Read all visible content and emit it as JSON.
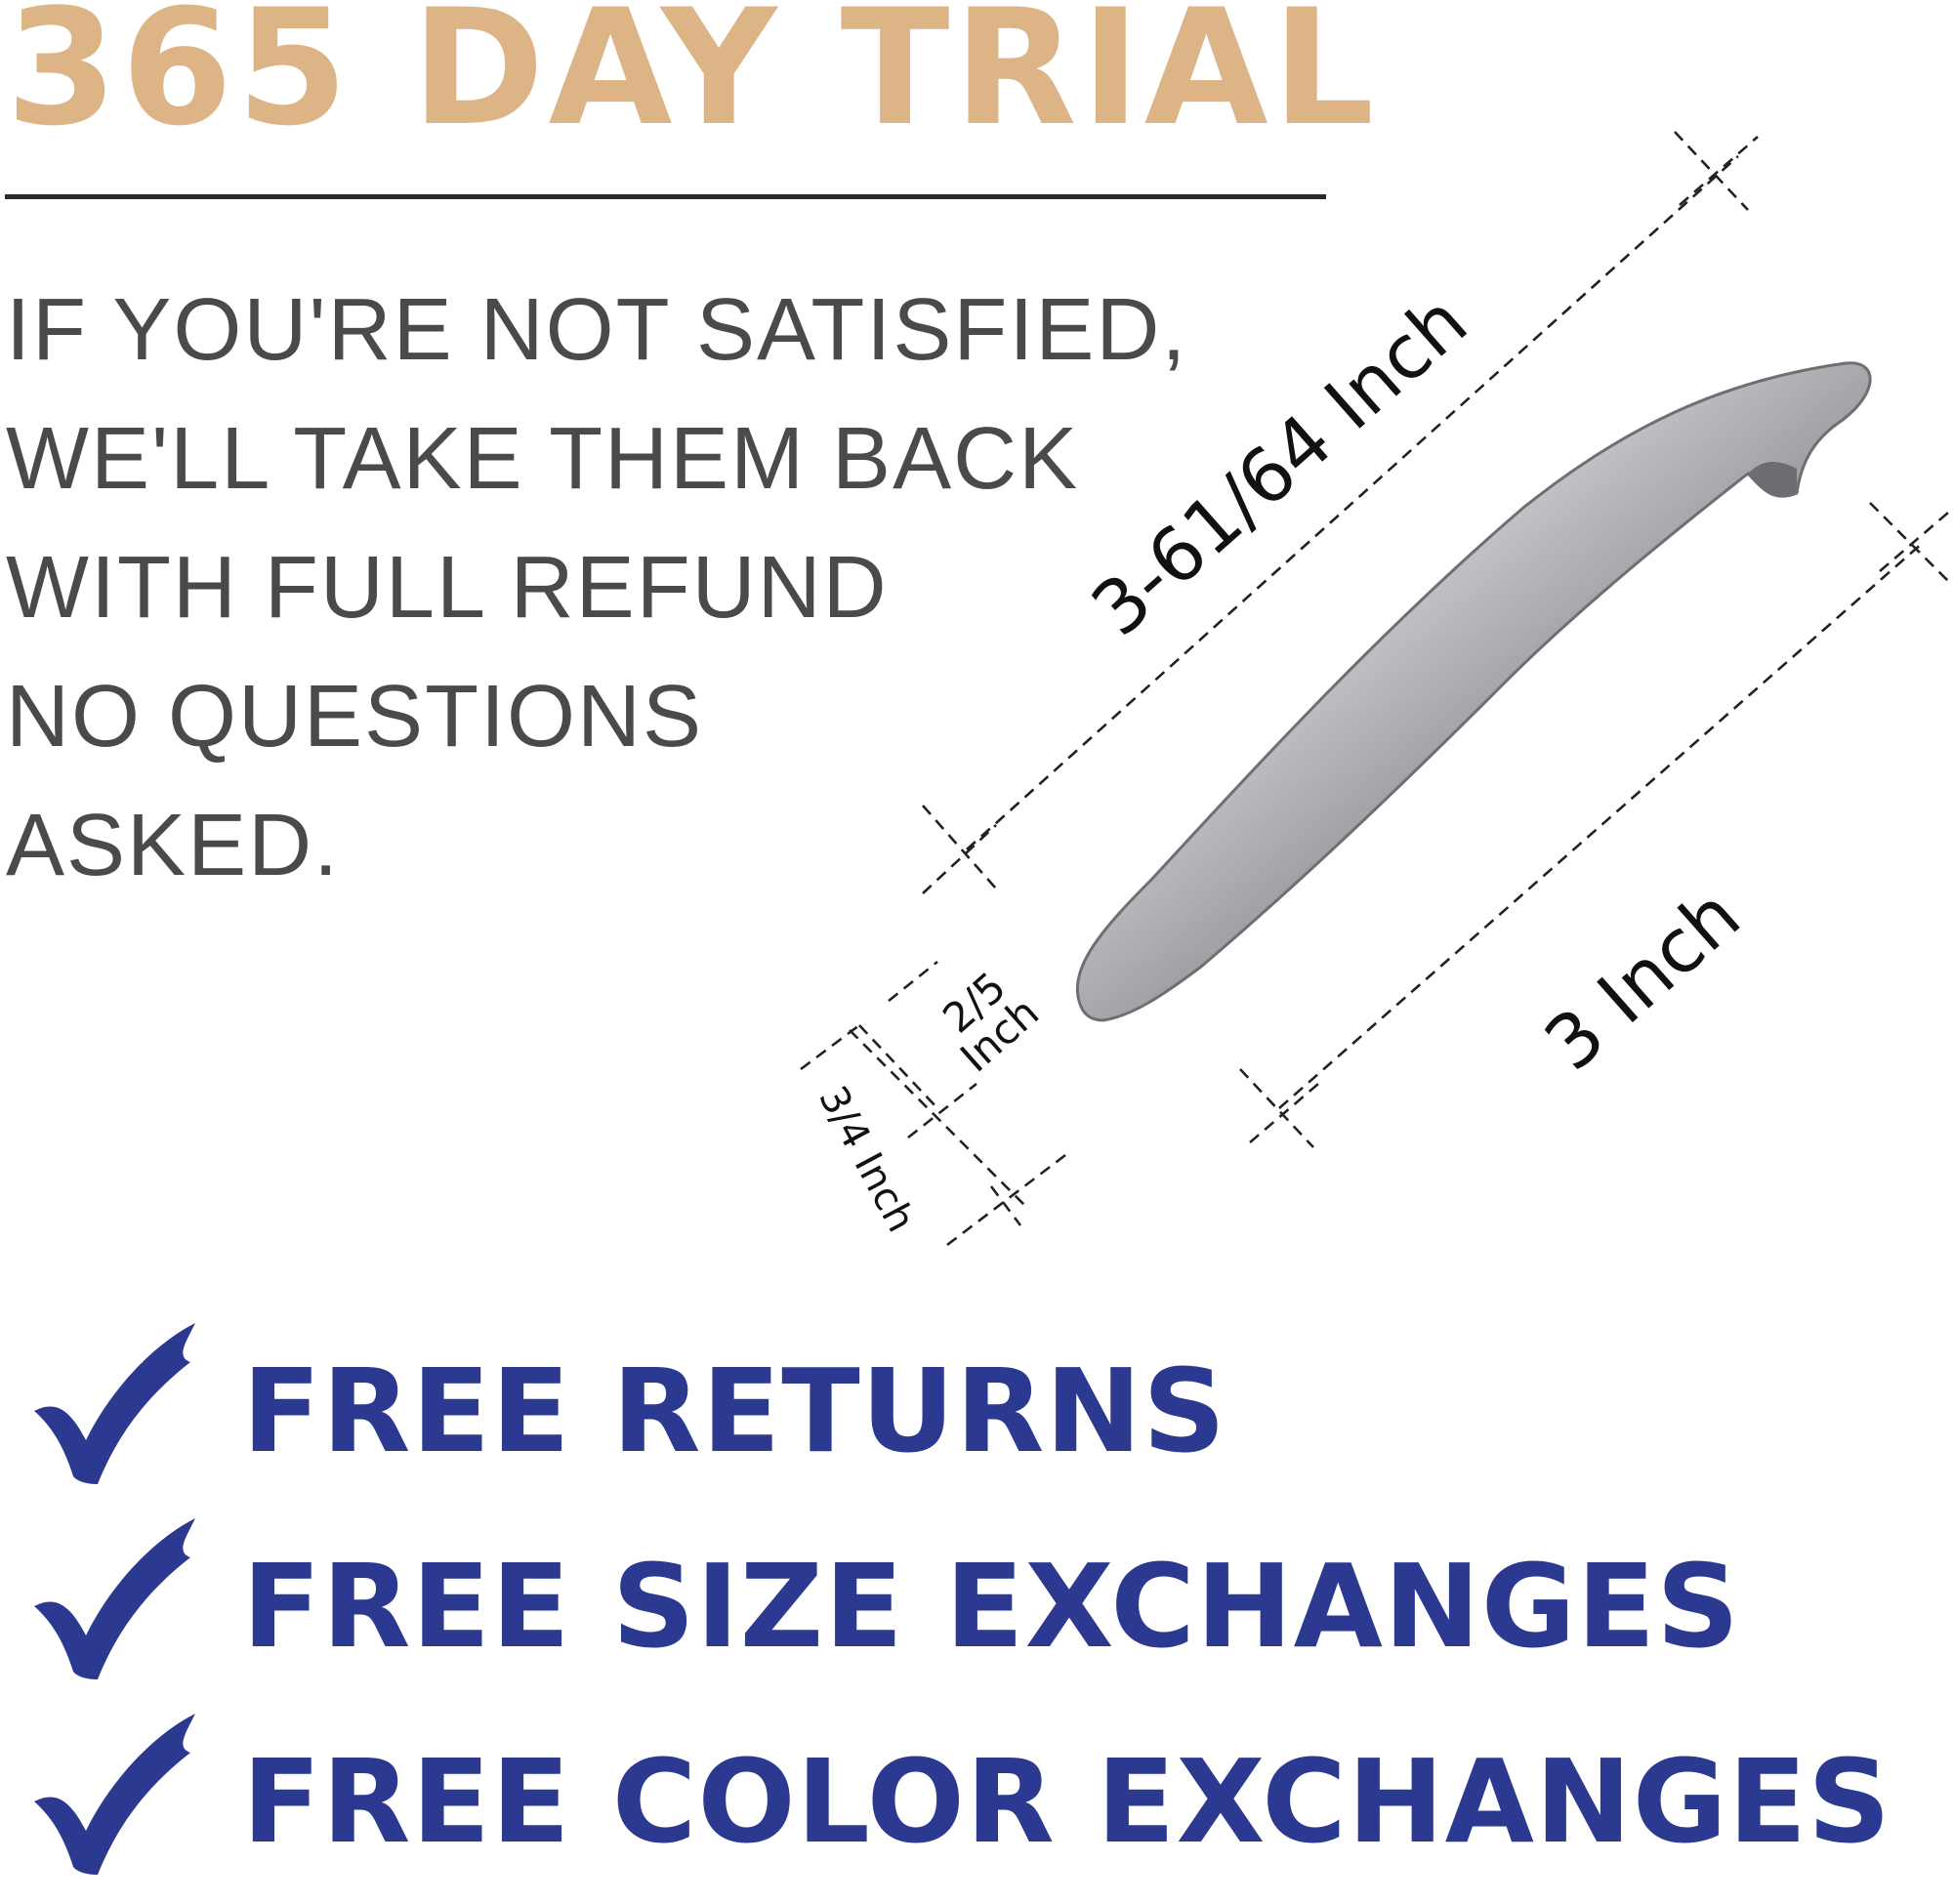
{
  "colors": {
    "title": "#dcb485",
    "text": "#4a4a4a",
    "rule": "#2a2a2a",
    "benefit": "#2b3990"
  },
  "trial_title": "365 DAY TRIAL",
  "promo_lines": [
    "IF YOU'RE NOT SATISFIED,",
    "WE'LL TAKE THEM BACK",
    "WITH FULL REFUND",
    "NO QUESTIONS",
    "ASKED."
  ],
  "dimensions": {
    "length": "3-61/64 Inch",
    "hole_spacing": "3 Inch",
    "width_fraction": "2/5",
    "width_unit": "Inch",
    "height": "3/4 Inch"
  },
  "benefits": [
    {
      "icon": "checkmark-icon",
      "label": "FREE RETURNS"
    },
    {
      "icon": "checkmark-icon",
      "label": "FREE SIZE EXCHANGES"
    },
    {
      "icon": "checkmark-icon",
      "label": "FREE COLOR EXCHANGES"
    }
  ]
}
